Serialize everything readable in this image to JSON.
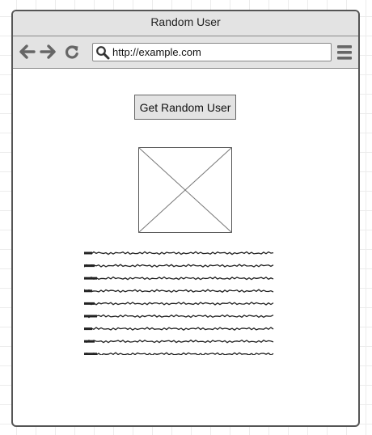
{
  "window": {
    "title": "Random User"
  },
  "toolbar": {
    "back_icon": "back-arrow-icon",
    "forward_icon": "forward-arrow-icon",
    "reload_icon": "reload-icon",
    "search_icon": "search-icon",
    "menu_icon": "hamburger-menu-icon",
    "url": "http://example.com"
  },
  "main": {
    "get_button_label": "Get Random User",
    "image_placeholder_icon": "image-placeholder-icon",
    "text_placeholder": "scribbled placeholder text lines",
    "text_line_count": 9
  },
  "colors": {
    "chrome": "#e3e3e3",
    "border": "#555555",
    "icon": "#666666"
  }
}
